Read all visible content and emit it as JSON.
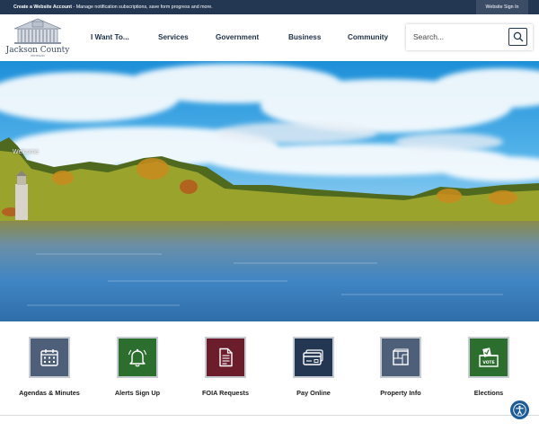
{
  "topbar": {
    "notice_bold": "Create a Website Account",
    "notice_rest": " - Manage notification subscriptions, save form progress and more.",
    "signin_label": "Website Sign In"
  },
  "logo": {
    "name": "Jackson County",
    "tagline": "MICHIGAN"
  },
  "nav": {
    "items": [
      {
        "label": "I Want To..."
      },
      {
        "label": "Services"
      },
      {
        "label": "Government"
      },
      {
        "label": "Business"
      },
      {
        "label": "Community"
      }
    ]
  },
  "search": {
    "placeholder": "Search...",
    "icon": "search-icon"
  },
  "hero": {
    "welcome": "Welcome"
  },
  "quick_links": [
    {
      "label": "Agendas & Minutes",
      "icon": "calendar-icon",
      "color": "#4e6079"
    },
    {
      "label": "Alerts Sign Up",
      "icon": "bell-icon",
      "color": "#2c6e2e"
    },
    {
      "label": "FOIA Requests",
      "icon": "document-icon",
      "color": "#6b1d2c"
    },
    {
      "label": "Pay Online",
      "icon": "credit-card-icon",
      "color": "#243752"
    },
    {
      "label": "Property Info",
      "icon": "map-icon",
      "color": "#4e6079"
    },
    {
      "label": "Elections",
      "icon": "ballot-box-icon",
      "color": "#2c6e2e"
    }
  ],
  "colors": {
    "topbar": "#243752",
    "nav_text": "#1e2f47",
    "accessibility": "#1d5d9b"
  },
  "accessibility": {
    "icon": "accessibility-icon"
  }
}
